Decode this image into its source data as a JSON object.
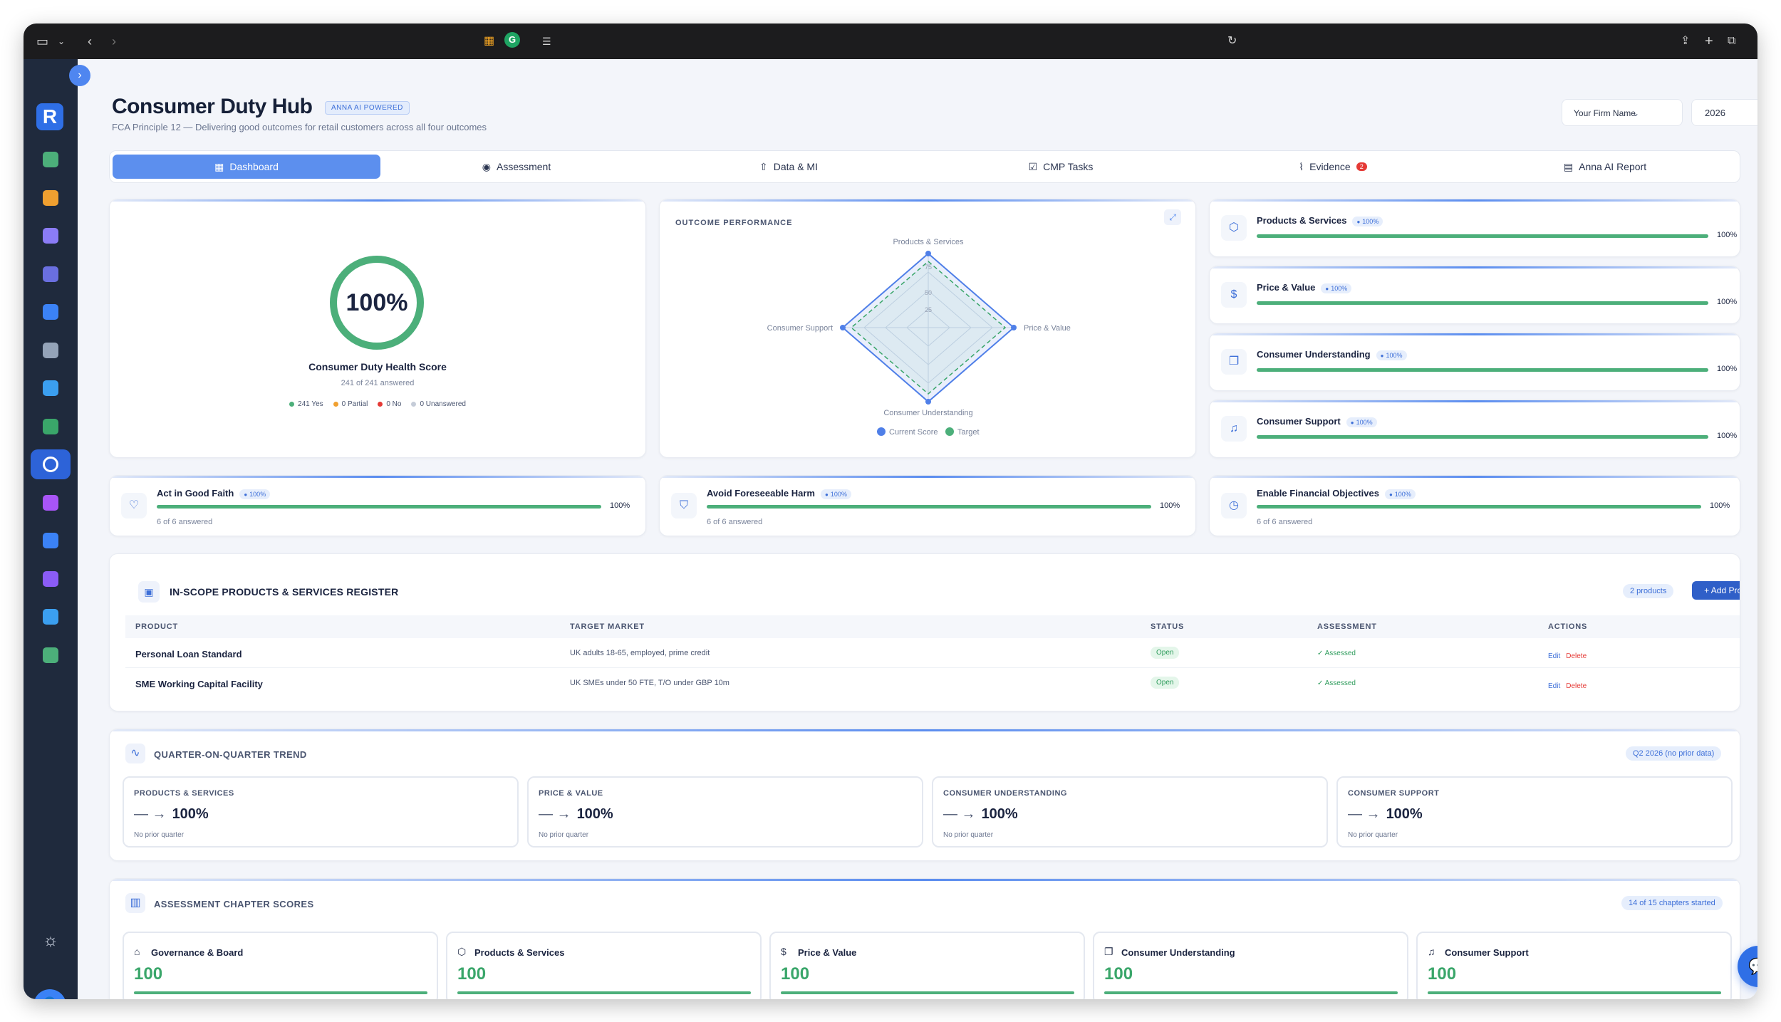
{
  "header": {
    "title": "Consumer Duty Hub",
    "ai_badge": "ANNA AI POWERED",
    "subtitle": "FCA Principle 12 — Delivering good outcomes for retail customers across all four outcomes",
    "firm_select": "Your Firm Name",
    "year_select": "2026"
  },
  "tabs": [
    {
      "label": "Dashboard",
      "icon": "grid-icon",
      "active": true
    },
    {
      "label": "Assessment",
      "icon": "check-circle-icon",
      "active": false
    },
    {
      "label": "Data & MI",
      "icon": "upload-icon",
      "active": false
    },
    {
      "label": "CMP Tasks",
      "icon": "checkbox-icon",
      "active": false
    },
    {
      "label": "Evidence",
      "icon": "paperclip-icon",
      "active": false,
      "badge": "2"
    },
    {
      "label": "Anna AI Report",
      "icon": "document-icon",
      "active": false
    }
  ],
  "health": {
    "score": "100%",
    "score_fraction": 1.0,
    "label": "Consumer Duty Health Score",
    "sub": "241 of 241 answered",
    "legend": [
      "241 Yes",
      "0 Partial",
      "0 No",
      "0 Unanswered"
    ],
    "legend_colors": [
      "#4caf7a",
      "#f0a030",
      "#e53935",
      "#c5ccd8"
    ]
  },
  "outcome_performance": {
    "title": "OUTCOME PERFORMANCE",
    "axes": [
      "Products & Services",
      "Price & Value",
      "Consumer Understanding",
      "Consumer Support"
    ],
    "ticks": [
      "75",
      "50",
      "25"
    ],
    "legend": [
      "Current Score",
      "Target"
    ],
    "colors": {
      "current": "#4f7fe8",
      "target": "#4caf7a"
    }
  },
  "outcomes": [
    {
      "title": "Products & Services",
      "pill": "100%",
      "pct": "100%",
      "fraction": 1.0,
      "icon": "cube-icon"
    },
    {
      "title": "Price & Value",
      "pill": "100%",
      "pct": "100%",
      "fraction": 1.0,
      "icon": "dollar-icon"
    },
    {
      "title": "Consumer Understanding",
      "pill": "100%",
      "pct": "100%",
      "fraction": 1.0,
      "icon": "book-icon"
    },
    {
      "title": "Consumer Support",
      "pill": "100%",
      "pct": "100%",
      "fraction": 1.0,
      "icon": "bell-icon"
    }
  ],
  "principles": [
    {
      "title": "Act in Good Faith",
      "pill": "100%",
      "pct": "100%",
      "sub": "6 of 6 answered",
      "fraction": 1.0,
      "icon": "heart-icon"
    },
    {
      "title": "Avoid Foreseeable Harm",
      "pill": "100%",
      "pct": "100%",
      "sub": "6 of 6 answered",
      "fraction": 1.0,
      "icon": "shield-icon"
    },
    {
      "title": "Enable Financial Objectives",
      "pill": "100%",
      "pct": "100%",
      "sub": "6 of 6 answered",
      "fraction": 1.0,
      "icon": "clock-icon"
    }
  ],
  "register": {
    "title": "IN-SCOPE PRODUCTS & SERVICES REGISTER",
    "count": "2 products",
    "add_label": "+ Add Product",
    "columns": [
      "PRODUCT",
      "TARGET MARKET",
      "STATUS",
      "ASSESSMENT",
      "ACTIONS"
    ],
    "rows": [
      {
        "product": "Personal Loan Standard",
        "market": "UK adults 18-65, employed, prime credit",
        "status": "Open",
        "assessment": "✓ Assessed",
        "edit": "Edit",
        "delete": "Delete"
      },
      {
        "product": "SME Working Capital Facility",
        "market": "UK SMEs under 50 FTE, T/O under GBP 10m",
        "status": "Open",
        "assessment": "✓ Assessed",
        "edit": "Edit",
        "delete": "Delete"
      }
    ]
  },
  "trend": {
    "title": "QUARTER-ON-QUARTER TREND",
    "badge": "Q2 2026 (no prior data)",
    "items": [
      {
        "label": "PRODUCTS & SERVICES",
        "arrow": "— →",
        "value": "100%",
        "note": "No prior quarter"
      },
      {
        "label": "PRICE & VALUE",
        "arrow": "— →",
        "value": "100%",
        "note": "No prior quarter"
      },
      {
        "label": "CONSUMER UNDERSTANDING",
        "arrow": "— →",
        "value": "100%",
        "note": "No prior quarter"
      },
      {
        "label": "CONSUMER SUPPORT",
        "arrow": "— →",
        "value": "100%",
        "note": "No prior quarter"
      }
    ]
  },
  "chapters": {
    "title": "ASSESSMENT CHAPTER SCORES",
    "badge": "14 of 15 chapters started",
    "items": [
      {
        "label": "Governance & Board",
        "value": "100",
        "icon": "building-icon"
      },
      {
        "label": "Products & Services",
        "value": "100",
        "icon": "cube-icon"
      },
      {
        "label": "Price & Value",
        "value": "100",
        "icon": "dollar-icon"
      },
      {
        "label": "Consumer Understanding",
        "value": "100",
        "icon": "book-icon"
      },
      {
        "label": "Consumer Support",
        "value": "100",
        "icon": "bell-icon"
      }
    ]
  },
  "sidebar": {
    "logo": "R",
    "items": [
      {
        "name": "nav-checklist",
        "color": "#4caf7a"
      },
      {
        "name": "nav-building",
        "color": "#f0a030"
      },
      {
        "name": "nav-people",
        "color": "#8b7cf6"
      },
      {
        "name": "nav-shield",
        "color": "#6a6fe0"
      },
      {
        "name": "nav-chart",
        "color": "#3b82f6"
      },
      {
        "name": "nav-news",
        "color": "#94a3b8"
      },
      {
        "name": "nav-monitor",
        "color": "#3b9ff0"
      },
      {
        "name": "nav-shield-check",
        "color": "#3aa66a"
      },
      {
        "name": "nav-consumer-duty",
        "color": "#ffffff",
        "active": true
      },
      {
        "name": "nav-save",
        "color": "#a855f7"
      },
      {
        "name": "nav-lock",
        "color": "#3b82f6"
      },
      {
        "name": "nav-list",
        "color": "#8b5cf6"
      },
      {
        "name": "nav-edit",
        "color": "#3b9ff0"
      },
      {
        "name": "nav-message",
        "color": "#4caf7a"
      }
    ]
  }
}
